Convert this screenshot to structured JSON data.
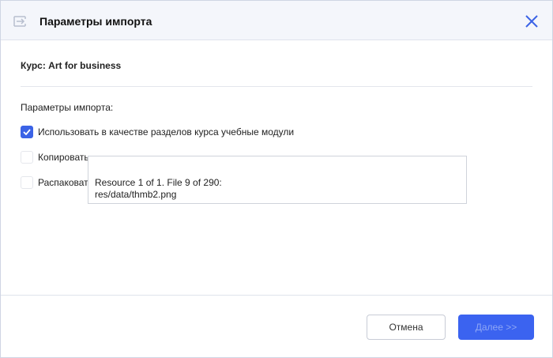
{
  "dialog": {
    "title": "Параметры импорта"
  },
  "course_label": "Курс: Art for business",
  "params_label": "Параметры импорта:",
  "options": [
    {
      "label": "Использовать в качестве разделов курса учебные модули",
      "checked": true
    },
    {
      "label": "Копировать",
      "checked": false
    },
    {
      "label": "Распаковат",
      "checked": false
    }
  ],
  "tooltip": {
    "line1": "Resource 1 of 1. File 9 of 290:",
    "line2": "res/data/thmb2.png"
  },
  "buttons": {
    "cancel": "Отмена",
    "next": "Далее >>"
  },
  "colors": {
    "accent": "#3b63e6"
  }
}
